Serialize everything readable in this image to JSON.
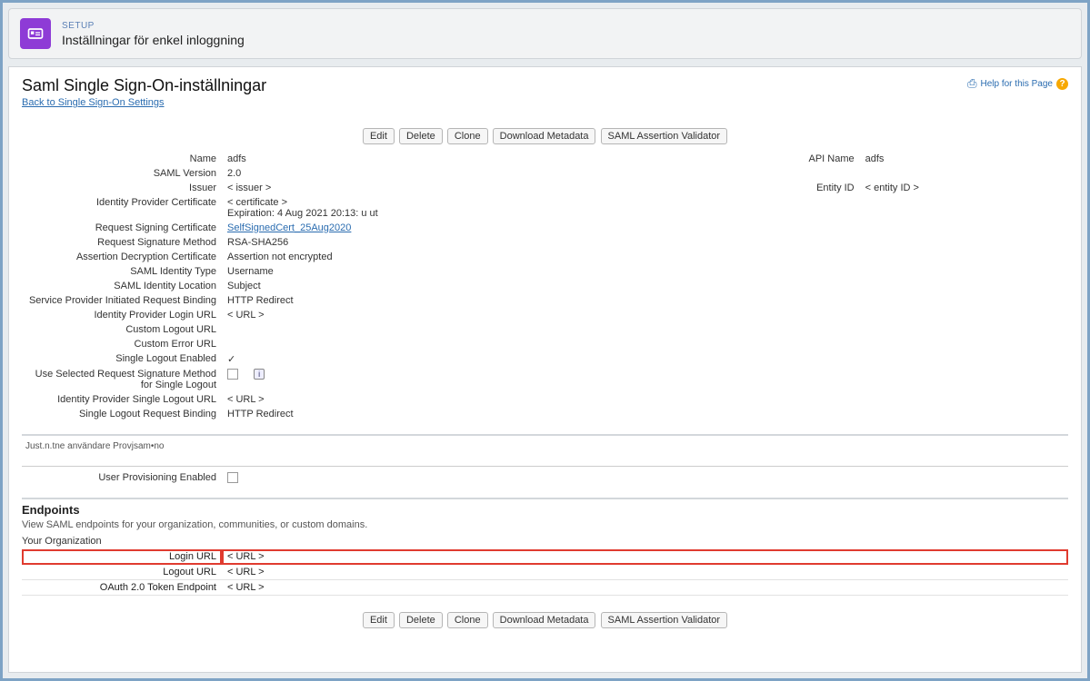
{
  "header": {
    "setup_label": "SETUP",
    "title": "Inställningar för enkel inloggning"
  },
  "page": {
    "title": "Saml Single Sign-On-inställningar",
    "back_link": "Back to Single Sign-On Settings",
    "help_text": "Help for this Page",
    "help_icon": "?"
  },
  "buttons": {
    "edit": "Edit",
    "delete": "Delete",
    "clone": "Clone",
    "download_metadata": "Download Metadata",
    "saml_validator": "SAML Assertion Validator"
  },
  "fields": {
    "name": {
      "label": "Name",
      "value": "adfs"
    },
    "api_name": {
      "label": "API Name",
      "value": "adfs"
    },
    "saml_version": {
      "label": "SAML Version",
      "value": "2.0"
    },
    "issuer": {
      "label": "Issuer",
      "value": "< issuer >"
    },
    "entity_id": {
      "label": "Entity ID",
      "value": "< entity ID >"
    },
    "idp_cert": {
      "label": "Identity Provider Certificate",
      "value": "< certificate >",
      "expiration": "Expiration: 4 Aug 2021 20:13: u ut"
    },
    "req_sign_cert": {
      "label": "Request Signing Certificate",
      "value": "SelfSignedCert_25Aug2020"
    },
    "req_sig_method": {
      "label": "Request Signature Method",
      "value": "RSA-SHA256"
    },
    "assert_decrypt": {
      "label": "Assertion Decryption Certificate",
      "value": "Assertion not encrypted"
    },
    "identity_type": {
      "label": "SAML Identity Type",
      "value": "Username"
    },
    "identity_location": {
      "label": "SAML Identity Location",
      "value": "Subject"
    },
    "sp_binding": {
      "label": "Service Provider Initiated Request Binding",
      "value": "HTTP Redirect"
    },
    "idp_login_url": {
      "label": "Identity Provider Login URL",
      "value": "< URL >"
    },
    "custom_logout": {
      "label": "Custom Logout URL",
      "value": ""
    },
    "custom_error": {
      "label": "Custom Error URL",
      "value": ""
    },
    "slo_enabled": {
      "label": "Single Logout Enabled",
      "value": "✓"
    },
    "use_req_sig": {
      "label": "Use Selected Request Signature Method for Single Logout",
      "info": "i"
    },
    "idp_slo_url": {
      "label": "Identity Provider Single Logout URL",
      "value": "< URL >"
    },
    "slo_binding": {
      "label": "Single Logout Request Binding",
      "value": "HTTP Redirect"
    }
  },
  "jit_section": {
    "label": "Just.n.tne användare Provjsam•no",
    "field": {
      "label": "User Provisioning Enabled"
    }
  },
  "endpoints": {
    "heading": "Endpoints",
    "subtext": "View SAML endpoints for your organization, communities, or custom domains.",
    "org_label": "Your Organization",
    "login": {
      "label": "Login URL",
      "value": "< URL >"
    },
    "logout": {
      "label": "Logout URL",
      "value": "< URL >"
    },
    "oauth": {
      "label": "OAuth 2.0 Token Endpoint",
      "value": "< URL >"
    }
  }
}
